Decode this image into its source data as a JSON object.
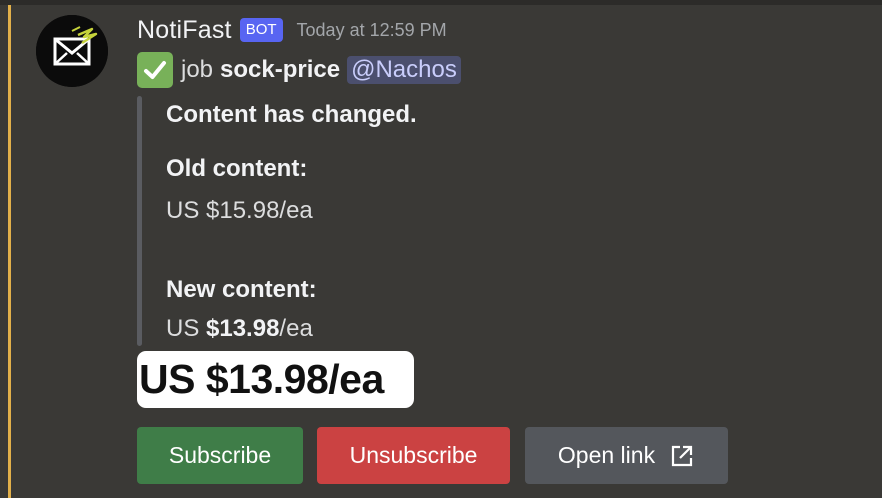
{
  "colors": {
    "background": "#3a3936",
    "mention_bar": "#e2b04a",
    "bot_tag": "#5865f2",
    "subscribe": "#3f7d48",
    "unsubscribe": "#cb4242",
    "open_link": "#54575c",
    "check_emoji": "#78b159"
  },
  "message": {
    "avatar_icon": "envelope-lightning-icon",
    "username": "NotiFast",
    "bot_tag": "BOT",
    "timestamp": "Today at 12:59 PM",
    "status_icon": "check-mark-emoji-icon",
    "job_word": "job",
    "job_name": "sock-price",
    "mention": "@Nachos"
  },
  "quote": {
    "heading": "Content has changed.",
    "old_label": "Old content:",
    "old_value": "US $15.98/ea",
    "new_label": "New content:",
    "new_prefix": "US",
    "new_amount": "$13.98",
    "new_suffix": "/ea"
  },
  "attachment": {
    "text": "US $13.98/ea"
  },
  "buttons": {
    "subscribe": "Subscribe",
    "unsubscribe": "Unsubscribe",
    "open_link": "Open link",
    "open_link_icon": "external-link-icon"
  }
}
